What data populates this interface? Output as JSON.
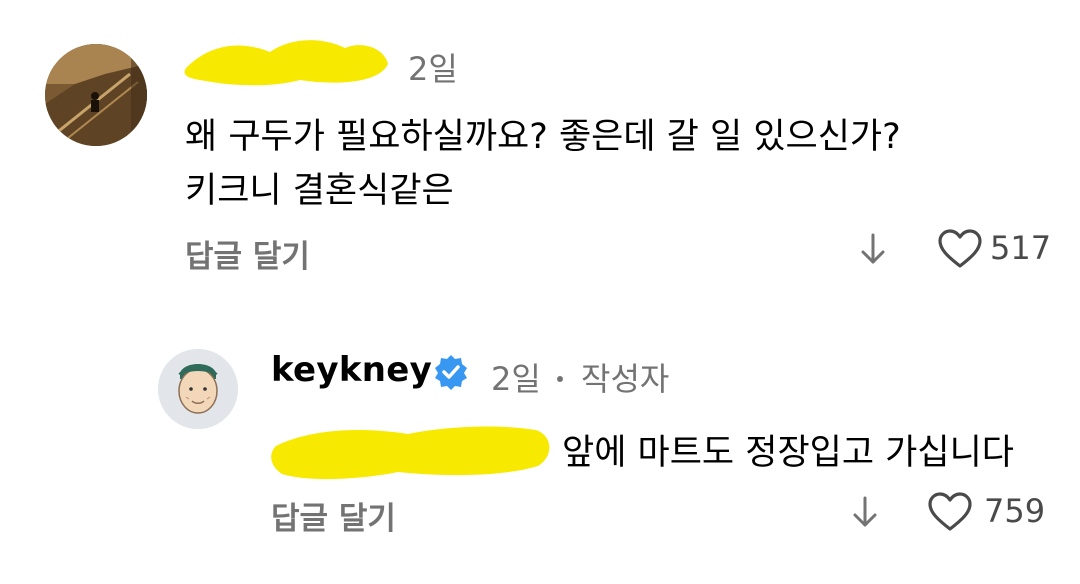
{
  "comments": [
    {
      "username_redacted": true,
      "time": "2일",
      "lines": [
        "왜 구두가 필요하실까요? 좋은데 갈 일 있으신가?",
        "키크니 결혼식같은"
      ],
      "reply_label": "답글 달기",
      "likes": "517",
      "avatar": "staircase-photo"
    },
    {
      "username": "keykney",
      "verified": true,
      "time": "2일",
      "author_badge": "작성자",
      "mention_redacted": true,
      "text": "앞에 마트도 정장입고 가십니다",
      "reply_label": "답글 달기",
      "likes": "759",
      "avatar": "cartoon-face"
    }
  ],
  "colors": {
    "redaction": "#f7ea00",
    "verified": "#3897f0",
    "secondary_text": "#737373"
  },
  "icons": {
    "collapse": "arrow-down-icon",
    "like": "heart-outline-icon",
    "verified": "verified-badge-icon"
  }
}
